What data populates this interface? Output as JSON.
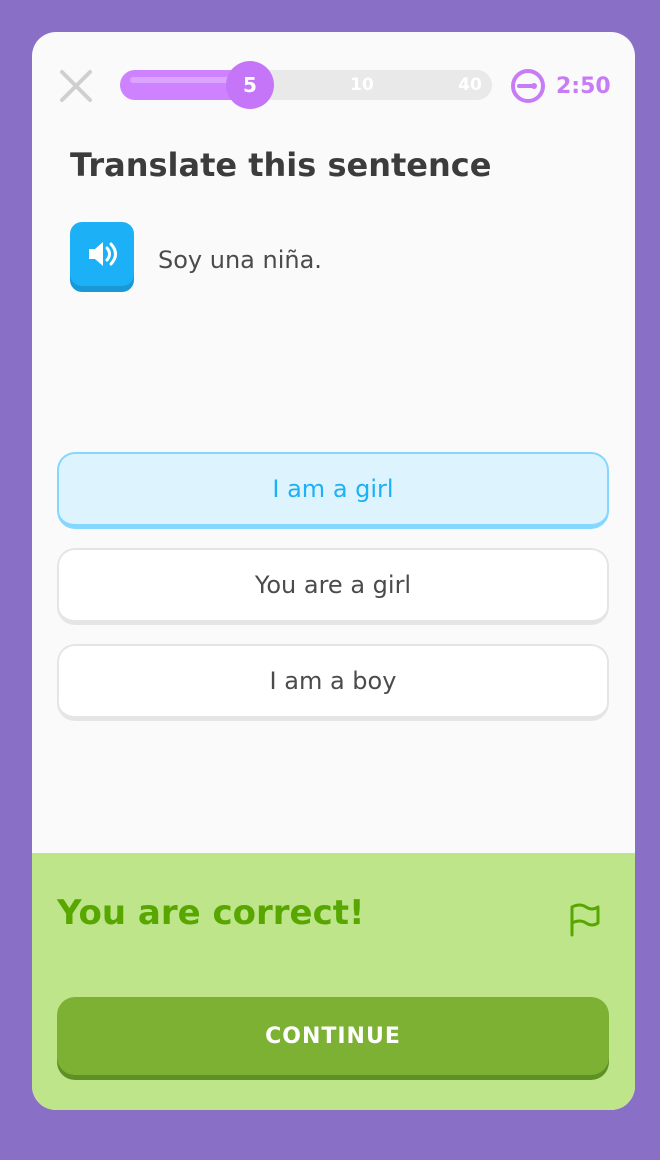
{
  "header": {
    "close_icon": "close-icon",
    "progress": {
      "fraction": 0.35,
      "milestones": [
        "5",
        "10",
        "40"
      ],
      "active_milestone": "5"
    },
    "timer": {
      "icon": "timer-key-icon",
      "value": "2:50"
    }
  },
  "question": {
    "title": "Translate this sentence",
    "audio_icon": "speaker-icon",
    "sentence": "Soy una niña."
  },
  "choices": [
    {
      "label": "I am a girl",
      "selected": true
    },
    {
      "label": "You are a girl",
      "selected": false
    },
    {
      "label": "I am a boy",
      "selected": false
    }
  ],
  "feedback": {
    "message": "You are correct!",
    "flag_icon": "flag-icon",
    "continue_label": "CONTINUE"
  },
  "colors": {
    "background": "#8a6fc6",
    "progress_fill": "#ce82ff",
    "selected_choice_bg": "#ddf4ff",
    "selected_choice_text": "#1cb0f6",
    "feedback_bg": "#bfe58b",
    "feedback_text": "#58a700",
    "continue_button": "#7cb134"
  }
}
